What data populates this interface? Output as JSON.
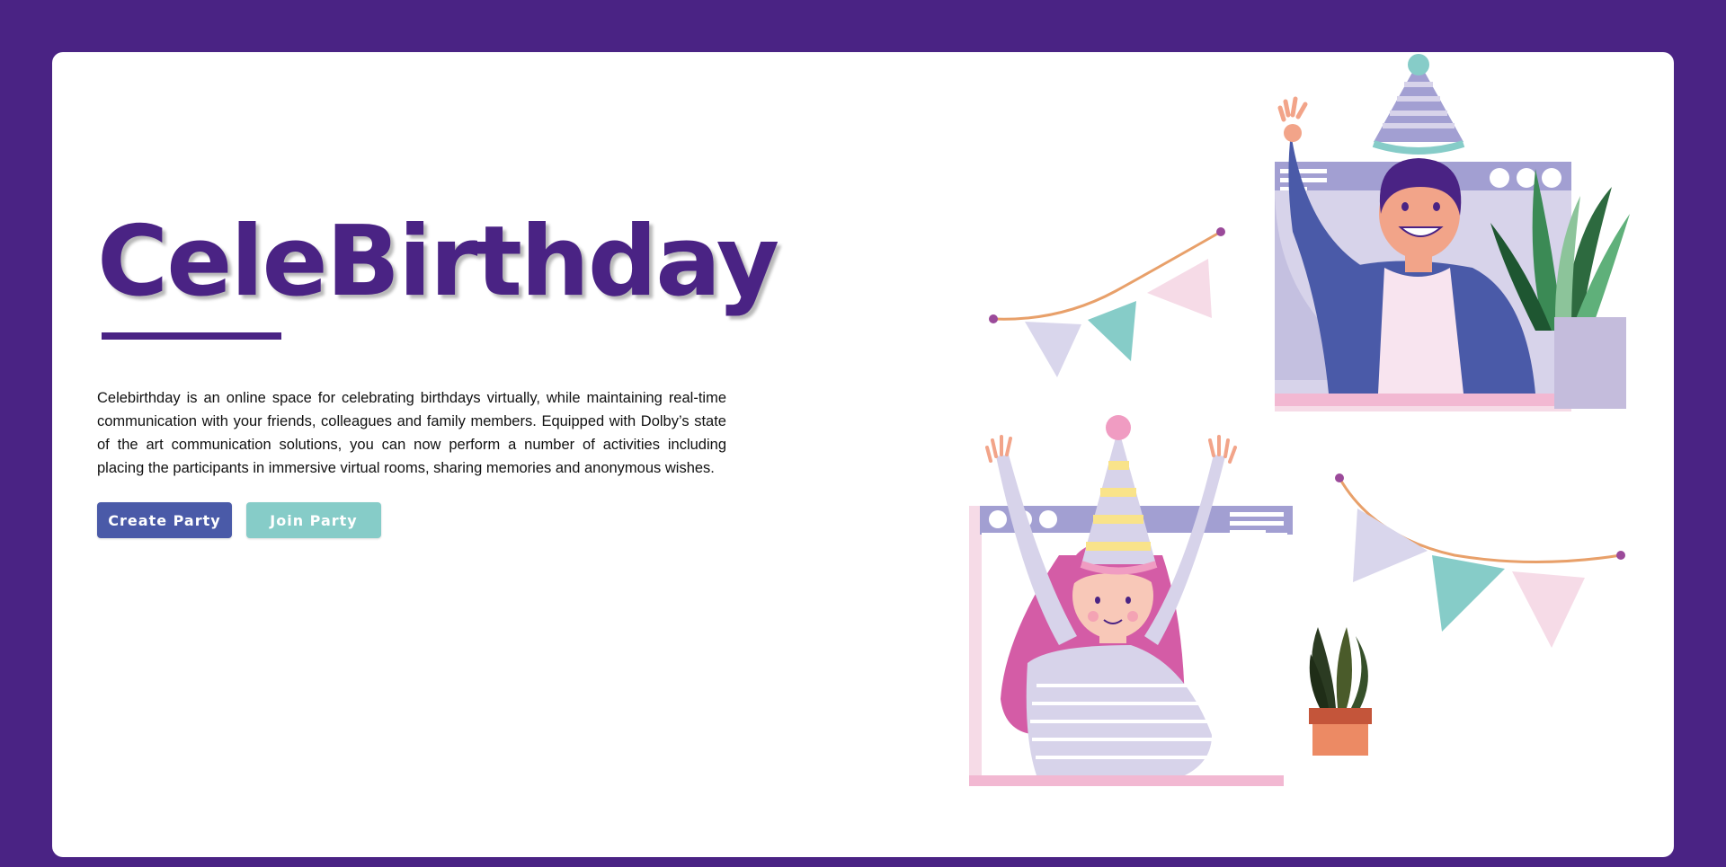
{
  "hero": {
    "title": "CeleBirthday",
    "description": "Celebirthday is an online space for celebrating birthdays virtually, while maintaining real-time communication with your friends, colleagues and family members. Equipped with Dolby’s state of the art communication solutions, you can now perform a number of activities including placing the participants in immersive virtual rooms, sharing memories and anonymous wishes."
  },
  "buttons": {
    "create_label": "Create Party",
    "join_label": "Join Party"
  },
  "colors": {
    "background": "#4a2384",
    "card": "#ffffff",
    "title": "#4a2384",
    "create_button": "#4a5aa8",
    "join_button": "#86ccc8"
  },
  "illustration": {
    "description_icons": [
      "party-hat-icon",
      "bunting-icon",
      "plant-icon",
      "browser-window-icon"
    ]
  }
}
